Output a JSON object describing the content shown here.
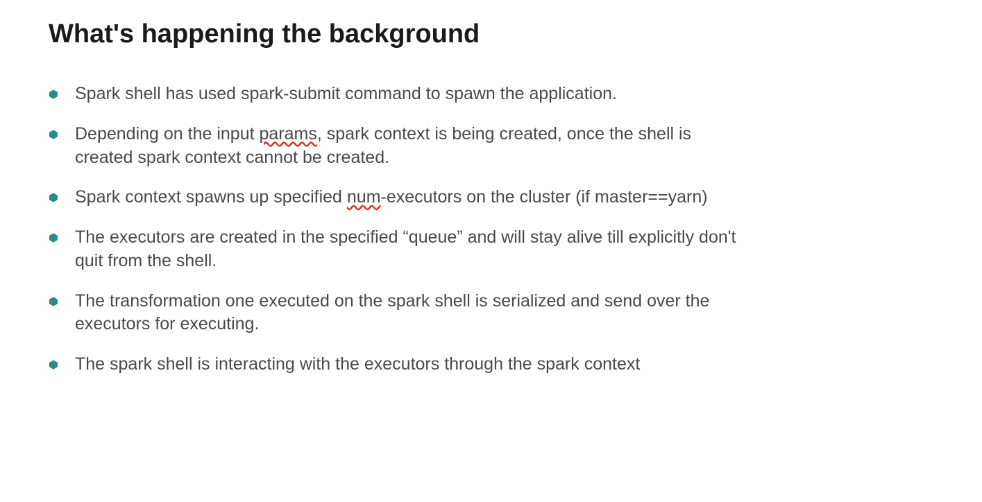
{
  "title": "What's happening the background",
  "colors": {
    "bullet": "#2a8b8b",
    "text": "#4a4a4a",
    "heading": "#1a1a1a"
  },
  "bullets": [
    {
      "pre": "Spark shell has used spark-submit command to spawn the application.",
      "spell": "",
      "post": ""
    },
    {
      "pre": "Depending on the input ",
      "spell": "params",
      "post": ", spark context is being created, once the shell is created spark context cannot be created."
    },
    {
      "pre": "Spark context spawns up specified  ",
      "spell": "num",
      "post": "-executors on the cluster (if master==yarn)"
    },
    {
      "pre": "The executors are created in the specified “queue” and will stay alive till explicitly don't quit from the shell.",
      "spell": "",
      "post": ""
    },
    {
      "pre": "The transformation one executed on the spark shell is serialized and send over the executors for executing.",
      "spell": "",
      "post": ""
    },
    {
      "pre": "The spark shell is interacting with the executors through the spark context",
      "spell": "",
      "post": ""
    }
  ]
}
